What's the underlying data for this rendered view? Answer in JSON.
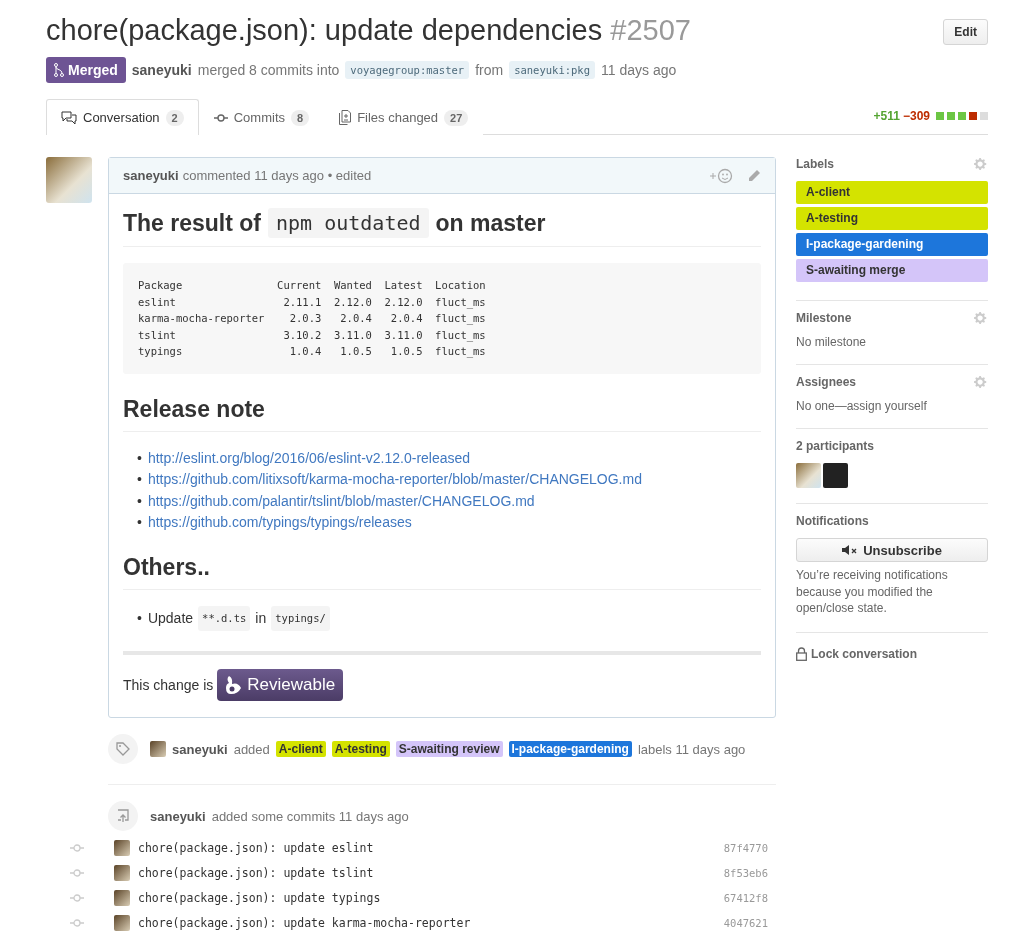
{
  "header": {
    "title": "chore(package.json): update dependencies",
    "number": "#2507",
    "edit_button": "Edit"
  },
  "status": {
    "badge": "Merged",
    "author": "saneyuki",
    "text": "merged 8 commits into",
    "base": "voyagegroup:master",
    "from": "from",
    "head": "saneyuki:pkg",
    "time": "11 days ago"
  },
  "tabs": [
    {
      "label": "Conversation",
      "count": "2",
      "selected": true,
      "kind": "conversation"
    },
    {
      "label": "Commits",
      "count": "8",
      "selected": false,
      "kind": "commits"
    },
    {
      "label": "Files changed",
      "count": "27",
      "selected": false,
      "kind": "files"
    }
  ],
  "diffstat": {
    "additions": "+511",
    "deletions": "−309",
    "blocks": [
      {
        "color": "#6cc644"
      },
      {
        "color": "#6cc644"
      },
      {
        "color": "#6cc644"
      },
      {
        "color": "#bd2c00"
      },
      {
        "color": "#dddddd"
      }
    ]
  },
  "comment": {
    "author": "saneyuki",
    "meta": "commented 11 days ago • edited",
    "heading": [
      {
        "kind": "text",
        "text": "The result of"
      },
      {
        "kind": "code",
        "text": "npm outdated"
      },
      {
        "kind": "text",
        "text": "on master"
      }
    ],
    "code_block": "Package               Current  Wanted  Latest  Location\neslint                 2.11.1  2.12.0  2.12.0  fluct_ms\nkarma-mocha-reporter    2.0.3   2.0.4   2.0.4  fluct_ms\ntslint                 3.10.2  3.11.0  3.11.0  fluct_ms\ntypings                 1.0.4   1.0.5   1.0.5  fluct_ms",
    "release_heading": "Release note",
    "bullet": "•",
    "links": [
      "http://eslint.org/blog/2016/06/eslint-v2.12.0-released",
      "https://github.com/litixsoft/karma-mocha-reporter/blob/master/CHANGELOG.md",
      "https://github.com/palantir/tslint/blob/master/CHANGELOG.md",
      "https://github.com/typings/typings/releases"
    ],
    "others_heading": "Others..",
    "others_item": [
      {
        "kind": "text",
        "text": "Update"
      },
      {
        "kind": "code",
        "text": "**.d.ts"
      },
      {
        "kind": "text",
        "text": "in"
      },
      {
        "kind": "code",
        "text": "typings/"
      }
    ],
    "footer_text": "This change is",
    "reviewable_button": "Reviewable"
  },
  "label_event": {
    "author": "saneyuki",
    "action": "added",
    "labels": [
      {
        "name": "A-client",
        "color": "#d4e300"
      },
      {
        "name": "A-testing",
        "color": "#d4e300"
      },
      {
        "name": "S-awaiting review",
        "color": "#d4c5f9"
      },
      {
        "name": "I-package-gardening",
        "color": "#1d76db"
      }
    ],
    "suffix": "labels 11 days ago"
  },
  "commits_event": {
    "author": "saneyuki",
    "text": "added some commits 11 days ago",
    "commits": [
      {
        "message": "chore(package.json): update eslint",
        "sha": "87f4770"
      },
      {
        "message": "chore(package.json): update tslint",
        "sha": "8f53eb6"
      },
      {
        "message": "chore(package.json): update typings",
        "sha": "67412f8"
      },
      {
        "message": "chore(package.json): update karma-mocha-reporter",
        "sha": "4047621"
      }
    ]
  },
  "sidebar": {
    "labels": {
      "title": "Labels",
      "items": [
        {
          "name": "A-client",
          "color": "#d4e300"
        },
        {
          "name": "A-testing",
          "color": "#d4e300"
        },
        {
          "name": "I-package-gardening",
          "color": "#1d76db"
        },
        {
          "name": "S-awaiting merge",
          "color": "#d4c5f9"
        }
      ]
    },
    "milestone": {
      "title": "Milestone",
      "value": "No milestone"
    },
    "assignees": {
      "title": "Assignees",
      "value": "No one—assign yourself"
    },
    "participants": {
      "title": "2 participants",
      "avatars": [
        {
          "kind": "photo"
        },
        {
          "kind": "glyph"
        }
      ]
    },
    "notifications": {
      "title": "Notifications",
      "button": "Unsubscribe",
      "reason": "You’re receiving notifications because you modified the open/close state."
    },
    "lock": "Lock conversation"
  }
}
